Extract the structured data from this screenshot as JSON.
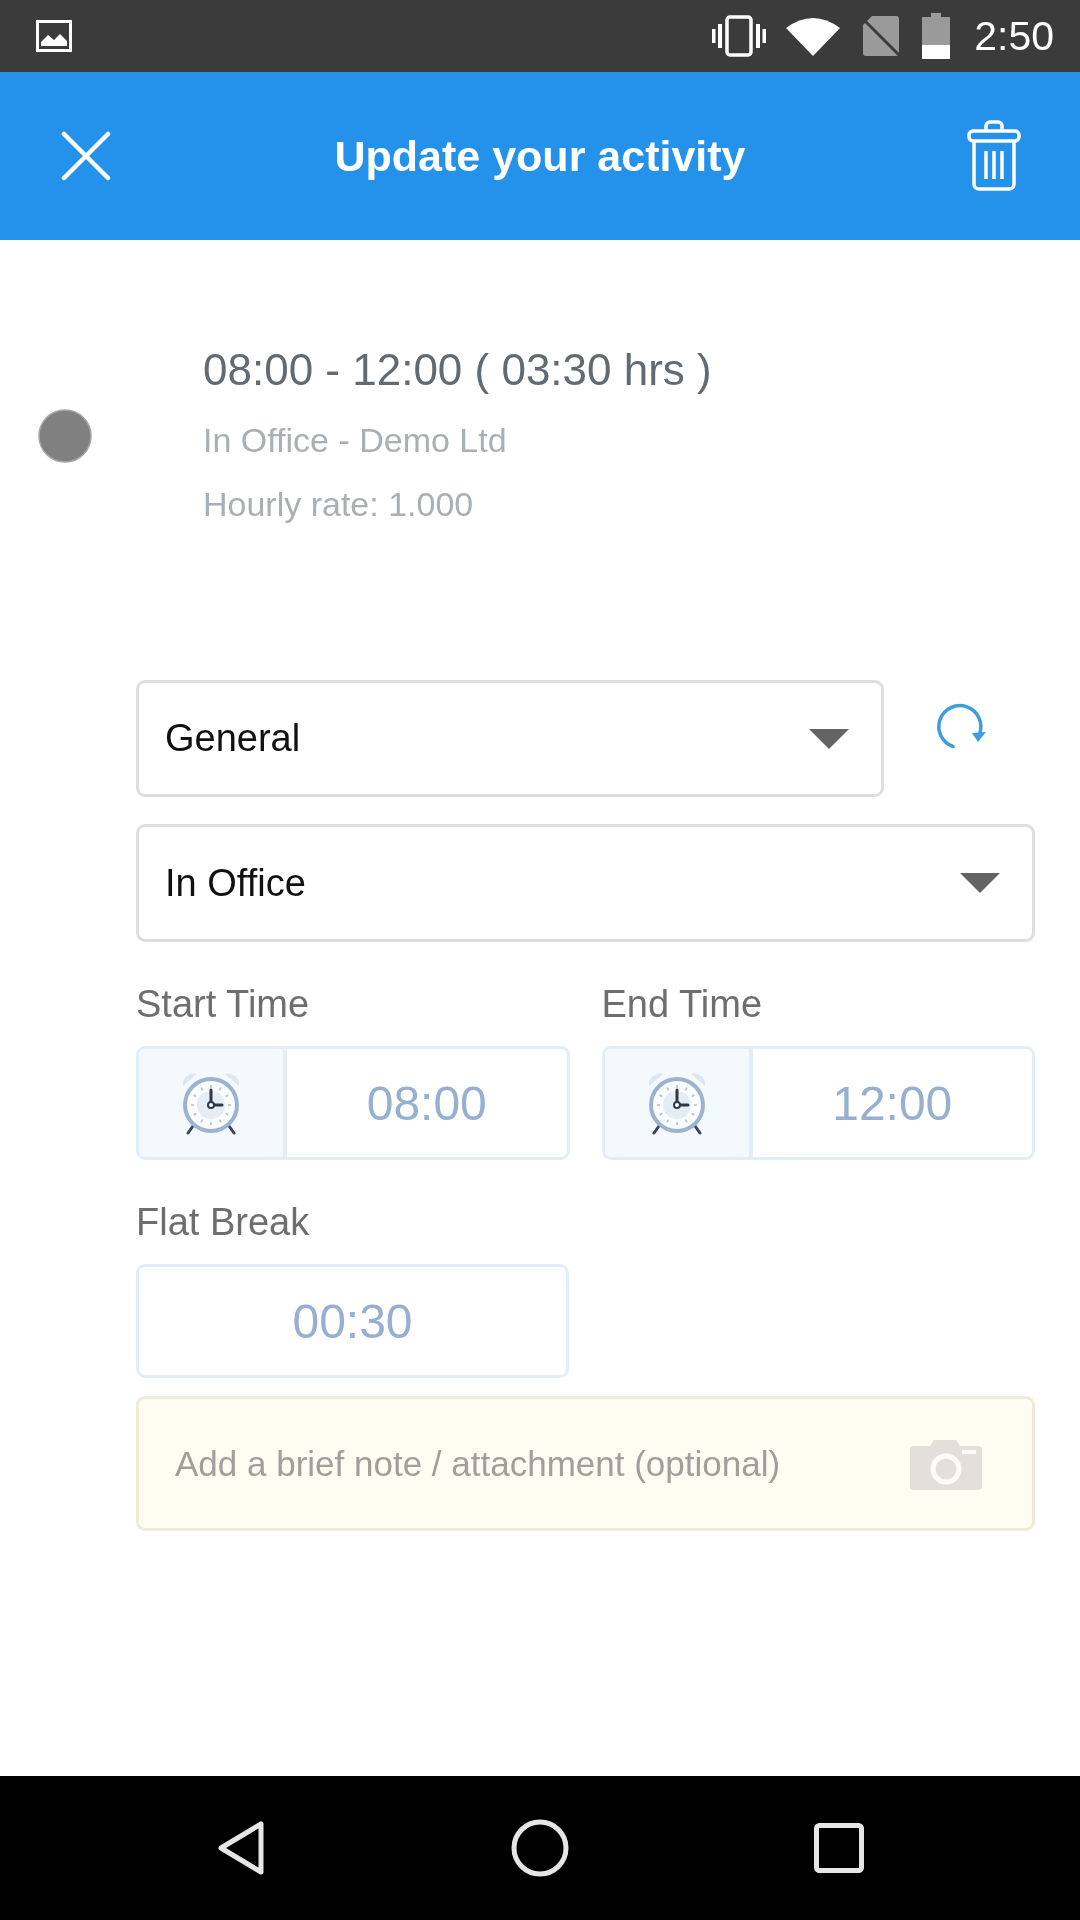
{
  "status_bar": {
    "time": "2:50"
  },
  "app_bar": {
    "title": "Update your activity"
  },
  "summary": {
    "time_range": "08:00 - 12:00 ( 03:30 hrs )",
    "location": "In Office - Demo Ltd",
    "hourly_rate": "Hourly rate: 1.000"
  },
  "form": {
    "category": {
      "value": "General"
    },
    "location": {
      "value": "In Office"
    },
    "times": [
      {
        "label": "Start Time",
        "value": "08:00"
      },
      {
        "label": "End Time",
        "value": "12:00"
      }
    ],
    "flat_break": {
      "label": "Flat Break",
      "value": "00:30"
    },
    "note": {
      "placeholder": "Add a brief note / attachment (optional)"
    }
  }
}
